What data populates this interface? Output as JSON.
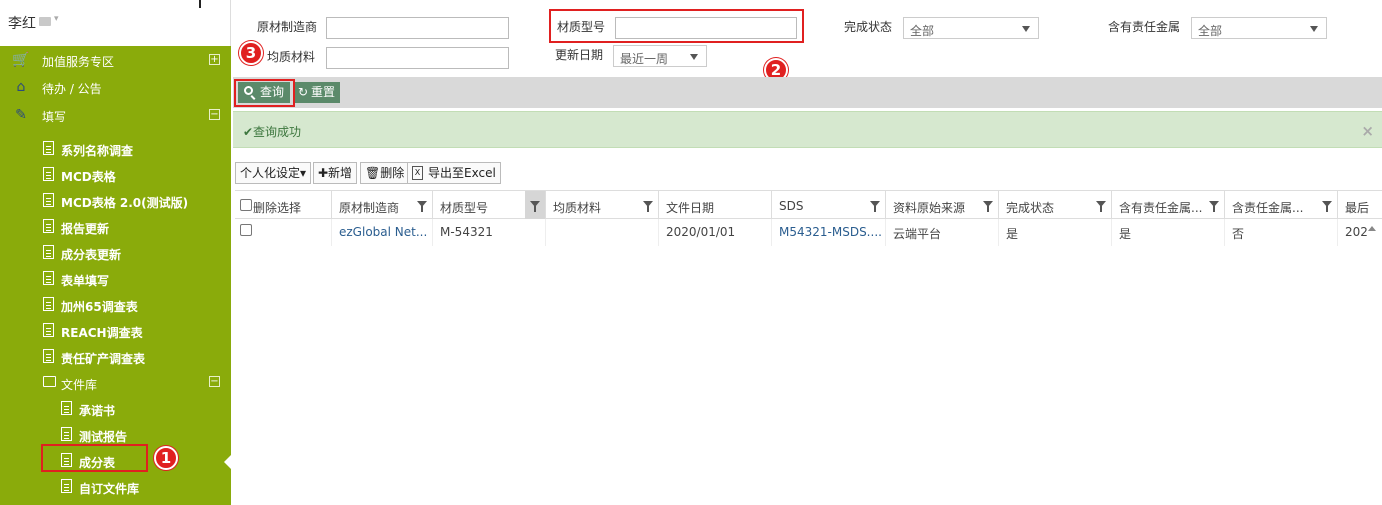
{
  "user": {
    "name": "李红"
  },
  "sidebar": {
    "top_items": [
      {
        "label": "加值服务专区",
        "toggle": "+"
      },
      {
        "label": "待办 / 公告"
      },
      {
        "label": "填写",
        "toggle": "−"
      }
    ],
    "sub_items": [
      "系列名称调查",
      "MCD表格",
      "MCD表格 2.0(测试版)",
      "报告更新",
      "成分表更新",
      "表单填写",
      "加州65调查表",
      "REACH调查表",
      "责任矿产调查表"
    ],
    "folder": {
      "label": "文件库",
      "toggle": "−"
    },
    "folder_items": [
      "承诺书",
      "测试报告",
      "成分表",
      "自订文件库"
    ]
  },
  "filters": {
    "manufacturer_label": "原材制造商",
    "material_no_label": "材质型号",
    "status_label": "完成状态",
    "status_value": "全部",
    "metal_label": "含有责任金属",
    "metal_value": "全部",
    "homogeneous_label": "均质材料",
    "update_label": "更新日期",
    "update_value": "最近一周"
  },
  "toolbar": {
    "query_label": "查询",
    "reset_label": "重置"
  },
  "alert": {
    "message": "✔查询成功",
    "close": "×"
  },
  "grid_tools": {
    "personalize": "个人化设定▾",
    "add": "✚新增",
    "delete": "🗑删除",
    "export": "导出至Excel"
  },
  "columns": [
    "删除选择",
    "原材制造商",
    "材质型号",
    "均质材料",
    "文件日期",
    "SDS",
    "资料原始来源",
    "完成状态",
    "含有责任金属...",
    "含责任金属...",
    "最后"
  ],
  "rows": [
    [
      "",
      "ezGlobal Net...",
      "M-54321",
      "",
      "2020/01/01",
      "M54321-MSDS....",
      "云端平台",
      "是",
      "是",
      "否",
      "202"
    ]
  ],
  "badges": [
    "1",
    "2",
    "3"
  ],
  "colors": {
    "sidebar": "#8aab0b",
    "accent_red": "#e02020",
    "button": "#5b8a6a",
    "success_bg": "#d6e8cf"
  }
}
